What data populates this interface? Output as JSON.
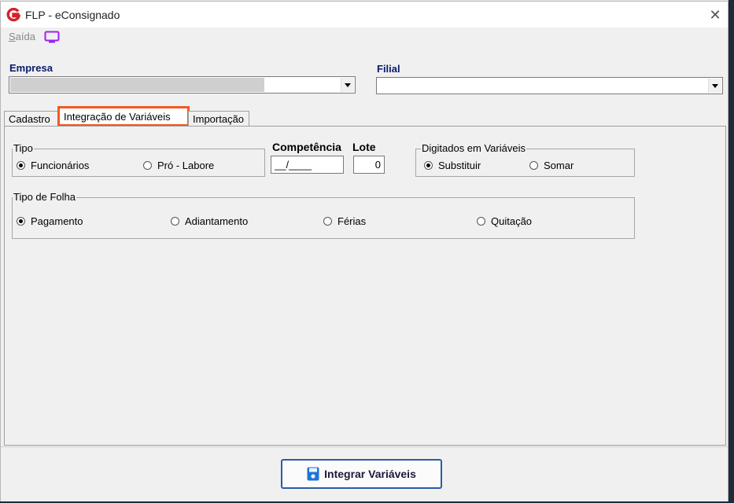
{
  "window": {
    "title": "FLP - eConsignado",
    "close_glyph": "✕"
  },
  "menu": {
    "saida_prefix": "S",
    "saida_rest": "aída",
    "monitor_icon": "monitor-icon"
  },
  "empresa": {
    "label": "Empresa",
    "value": ""
  },
  "filial": {
    "label": "Filial",
    "value": ""
  },
  "tabs": [
    {
      "label": "Cadastro",
      "active": false
    },
    {
      "label": "Integração de Variáveis",
      "active": true
    },
    {
      "label": "Importação",
      "active": false
    }
  ],
  "tipo": {
    "title": "Tipo",
    "options": [
      {
        "label": "Funcionários",
        "checked": true
      },
      {
        "label": "Pró - Labore",
        "checked": false
      }
    ]
  },
  "competencia": {
    "label": "Competência",
    "value": "__/____"
  },
  "lote": {
    "label": "Lote",
    "value": "0"
  },
  "digitados": {
    "title": "Digitados em Variáveis",
    "options": [
      {
        "label": "Substituir",
        "checked": true
      },
      {
        "label": "Somar",
        "checked": false
      }
    ]
  },
  "tipo_folha": {
    "title": "Tipo de Folha",
    "options": [
      {
        "label": "Pagamento",
        "checked": true
      },
      {
        "label": "Adiantamento",
        "checked": false
      },
      {
        "label": "Férias",
        "checked": false
      },
      {
        "label": "Quitação",
        "checked": false
      }
    ]
  },
  "actions": {
    "integrar_label": "Integrar Variáveis"
  },
  "colors": {
    "accent_orange": "#f15a1f",
    "label_blue": "#0a1a6b",
    "button_border": "#2d5aa8"
  }
}
